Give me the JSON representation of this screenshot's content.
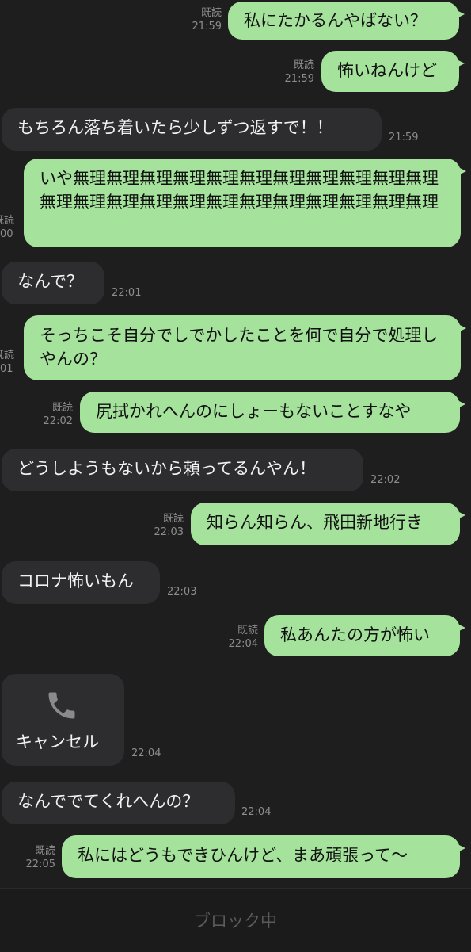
{
  "read_label": "既読",
  "messages": [
    {
      "id": "m1",
      "text": "私にたかるんやばない？",
      "time": "21:59"
    },
    {
      "id": "m2",
      "text": "怖いねんけど",
      "time": "21:59"
    },
    {
      "id": "m3",
      "text": "もちろん落ち着いたら少しずつ返すで！！",
      "time": "21:59"
    },
    {
      "id": "m4",
      "text": "いや無理無理無理無理無理無理無理無理無理無理無理無理無理無理無理無理無理無理無理無理無理無理無理",
      "time": "00"
    },
    {
      "id": "m5",
      "text": "なんで？",
      "time": "22:01"
    },
    {
      "id": "m6",
      "text": "そっちこそ自分でしでかしたことを何で自分で処理しやんの？",
      "time": "01"
    },
    {
      "id": "m7",
      "text": "尻拭かれへんのにしょーもないことすなや",
      "time": "22:02"
    },
    {
      "id": "m8",
      "text": "どうしようもないから頼ってるんやん！",
      "time": "22:02"
    },
    {
      "id": "m9",
      "text": "知らん知らん、飛田新地行き",
      "time": "22:03"
    },
    {
      "id": "m10",
      "text": "コロナ怖いもん",
      "time": "22:03"
    },
    {
      "id": "m11",
      "text": "私あんたの方が怖い",
      "time": "22:04"
    },
    {
      "id": "m12",
      "text": "キャンセル",
      "time": "22:04"
    },
    {
      "id": "m13",
      "text": "なんででてくれへんの？",
      "time": "22:04"
    },
    {
      "id": "m14",
      "text": "私にはどうもできひんけど、まあ頑張って〜",
      "time": "22:05"
    }
  ],
  "call": {
    "icon": "phone-icon",
    "label": "キャンセル"
  },
  "footer": {
    "blocked_label": "ブロック中"
  },
  "colors": {
    "sent_bubble": "#a5e29c",
    "received_bubble": "#2d2d2f",
    "background": "#1e1e1e"
  }
}
